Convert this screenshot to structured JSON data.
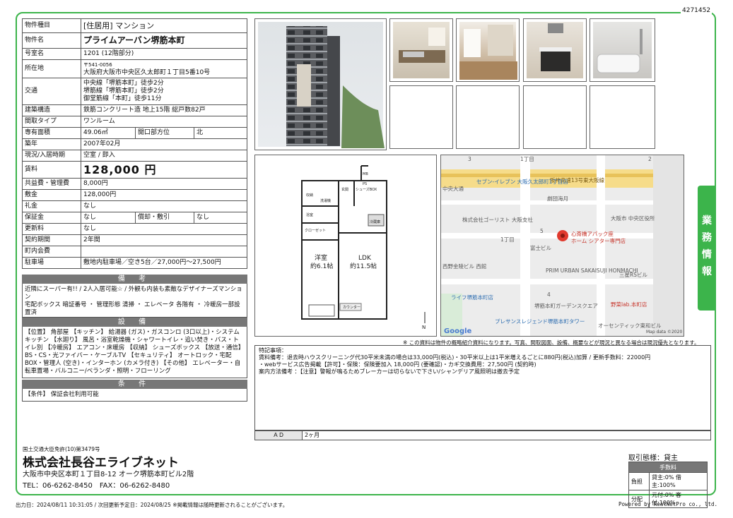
{
  "doc_id": "4271452",
  "spec": {
    "type_label": "物件種目",
    "type_value": "[住居用] マンション",
    "name_label": "物件名",
    "name_value": "プライムアーバン堺筋本町",
    "room_label": "号室名",
    "room_value": "1201 (12階部分)",
    "addr_label": "所在地",
    "addr_zip": "〒541-0056",
    "addr_value": "大阪府大阪市中央区久太郎町１丁目5番10号",
    "traffic_label": "交通",
    "traffic_1": "中央線「堺筋本町」徒歩2分",
    "traffic_2": "堺筋線「堺筋本町」徒歩2分",
    "traffic_3": "御堂筋線「本町」徒歩11分",
    "struct_label": "建築構造",
    "struct_value": "鉄筋コンクリート造 地上15階 総戸数82戸",
    "layout_label": "間取タイプ",
    "layout_value": "ワンルーム",
    "area_label": "専有面積",
    "area_value": "49.06㎡",
    "dir_label": "開口部方位",
    "dir_value": "北",
    "built_label": "築年",
    "built_value": "2007年02月",
    "status_label": "現況/入居時期",
    "status_value": "空室 / 即入",
    "rent_label": "賃料",
    "rent_value": "128,000 円",
    "common_label": "共益費・管理費",
    "common_value": "8,000円",
    "deposit_label": "敷金",
    "deposit_value": "128,000円",
    "key_label": "礼金",
    "key_value": "なし",
    "guar_label": "保証金",
    "guar_value": "なし",
    "amort_label": "償却・敷引",
    "amort_value": "なし",
    "renew_label": "更新料",
    "renew_value": "なし",
    "term_label": "契約期間",
    "term_value": "2年間",
    "assoc_label": "町内会費",
    "assoc_value": "",
    "parking_label": "駐車場",
    "parking_value": "敷地内駐車場／空き5台／27,000円～27,500円"
  },
  "sections": {
    "remarks_title": "備 考",
    "remarks_text": "近隣にスーパー有!! / 2人入居可能☆ / 外観も内装も素敵なデザイナーズマンション\n宅配ボックス 暗証番号 ・ 管理形態 清掃 ・ エレベータ 各階有 ・ 冷暖房一部設置済",
    "equip_title": "設 備",
    "equip_text": "【位置】 角部屋 【キッチン】 給湯器 (ガス)・ガスコンロ (3口以上)・システムキッチン 【水廻り】 風呂・浴室乾燥機・シャワートイレ・追い焚き・バス・トイレ別 【冷暖房】 エアコン・床暖房 【収納】 シューズボックス 【放送・通信】 BS・CS・光ファイバー・ケーブルTV 【セキュリティ】 オートロック・宅配BOX・管理人 (空き)・インターホン (カメラ付き) 【その他】 エレベーター・自転車置場・バルコニー/ベランダ・照明・フローリング",
    "cond_title": "条 件",
    "cond_text": "【条件】 保証会社利用可能"
  },
  "floorplan": {
    "room1": "洋室",
    "room1_size": "約6.1帖",
    "room2": "LDK",
    "room2_size": "約11.5帖",
    "labels": [
      "収納",
      "洗濯機",
      "浴室",
      "冷蔵庫",
      "クローゼット",
      "シューズBOX",
      "カウンター",
      "MB",
      "PS",
      "玄関"
    ],
    "north": "N"
  },
  "map": {
    "labels": [
      "1丁目",
      "阪神高速13号東大阪線",
      "セブン-イレブン 大阪久太郎町1丁目店",
      "中央大通",
      "株式会社ゴーリスト 大阪支社",
      "劇団海月",
      "大阪市 中央区役所",
      "心斎橋アパック座",
      "ホーム シアター専門店",
      "1丁目",
      "富士ビル",
      "西野金陵ビル 西館",
      "PRIM URBAN SAKAISUJI HONMACHI",
      "三星RSビル",
      "ライフ堺筋本町店",
      "堺筋本町ガーデンスクエア",
      "プレサンスレジェンド堺筋本町タワー",
      "野菜lab.本町店",
      "オーセンティック東和ビル"
    ],
    "map_numbers": [
      "3",
      "2",
      "5",
      "4"
    ],
    "brand": "Google",
    "copyright": "Map data ©2020"
  },
  "side_tab": "業務情報",
  "note": "※ この資料は物件の概略紹介資料になります。写真、間取図面、設備、概要などが現況と異なる場合は現況優先となります。",
  "special": {
    "title": "特記事項：",
    "line1": "賃料備考：退去時ハウスクリーニング代30平米未満の場合は33,000円(税込)・30平米以上は1平米増えるごとに880円(税込)加算 / 更新手数料：22000円",
    "line2": "・webサービス広告掲載【許可】・保険：保険要加入 18,000円 (要確認)・カギ交換費用：27,500円 (契約時)",
    "line3": "案内方法備考 ：【注意】警報が鳴るためブレーカーは切らないで下さい/シャンデリア風照明は撤去予定",
    "ad_label": "ＡＤ",
    "ad_value": "2ヶ月"
  },
  "company": {
    "license": "国土交通大臣免許(10)第3479号",
    "name": "株式会社長谷エライブネット",
    "address": "大阪市中央区本町１丁目8-12 オーク堺筋本町ビル2階",
    "tel": "TEL：06-6262-8450　FAX：06-6262-8480"
  },
  "fee": {
    "title": "取引態様：貸主",
    "header": "手数料",
    "burden": "負担",
    "burden_value": "貸主:0% 借主:100%",
    "split": "分配",
    "split_value": "元付:0% 客付:100%"
  },
  "footer": {
    "left": "出力日：2024/08/11 10:31:05 / 次回更新予定日：2024/08/25 ※掲載情報は随時更新されることがございます。",
    "right": "Powered by RealNetPro co., ltd."
  },
  "colors": {
    "accent": "#3cb44b",
    "section": "#777777",
    "map_bg": "#e8e8e8",
    "road": "#f4d57a"
  }
}
